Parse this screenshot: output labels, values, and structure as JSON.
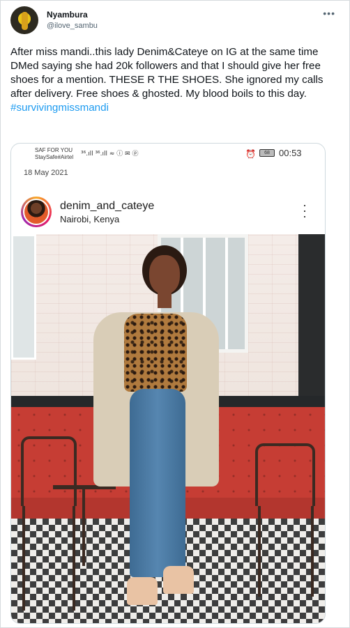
{
  "tweet": {
    "name": "Nyambura",
    "handle": "@ilove_sambu",
    "more_icon": "more-horizontal-icon",
    "text": "After miss mandi..this lady Denim&Cateye on IG at the same time DMed saying she had 20k followers and that I should give her free shoes for a mention. THESE R THE SHOES. She ignored my calls after delivery. Free shoes & ghosted. My blood boils to this day.",
    "hashtag": "#survivingmissmandi",
    "hashtag_color": "#1d9bf0"
  },
  "screenshot": {
    "status": {
      "carrier_line1": "SAF FOR YOU",
      "carrier_line2": "StaySafe#Airtel",
      "signal_icons": "³⁶.ıll ³⁶.ıll ≈ ⓘ ✉ ⓟ",
      "alarm_icon": "alarm-clock-icon",
      "battery": "68",
      "time": "00:53"
    },
    "date": "18 May 2021",
    "post": {
      "username": "denim_and_cateye",
      "location": "Nairobi, Kenya",
      "menu_icon": "more-vertical-icon"
    }
  }
}
